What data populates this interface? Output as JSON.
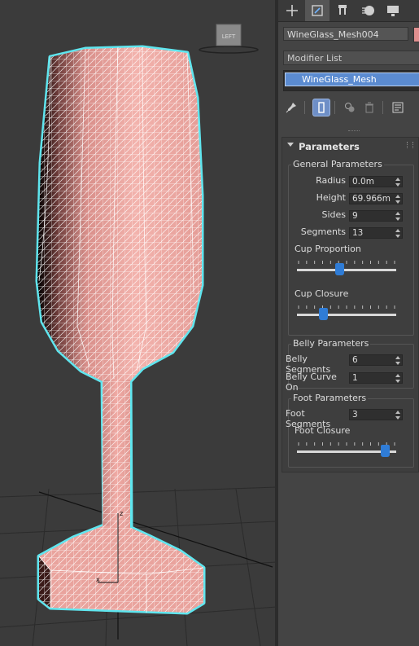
{
  "viewport": {
    "label": "LEFT",
    "background": "#3b3b3b",
    "mesh_color": "#eaa09a",
    "wire_color": "#ffffff",
    "selection_outline_color": "#5fe6ef"
  },
  "command_panel": {
    "tabs": [
      {
        "name": "create-tab",
        "icon": "plus-icon"
      },
      {
        "name": "modify-tab",
        "icon": "modify-icon",
        "active": true
      },
      {
        "name": "hierarchy-tab",
        "icon": "hierarchy-icon"
      },
      {
        "name": "motion-tab",
        "icon": "motion-icon"
      },
      {
        "name": "display-tab",
        "icon": "display-icon"
      }
    ],
    "object_name": "WineGlass_Mesh004",
    "object_color": "#e08f8f",
    "modifier_list_label": "Modifier List",
    "modifier_stack": [
      "WineGlass_Mesh"
    ]
  },
  "parameters": {
    "title": "Parameters",
    "general": {
      "title": "General Parameters",
      "radius_label": "Radius",
      "radius_value": "0.0m",
      "height_label": "Height",
      "height_value": "69.966m",
      "sides_label": "Sides",
      "sides_value": "9",
      "segments_label": "Segments",
      "segments_value": "13",
      "cup_proportion_label": "Cup Proportion",
      "cup_proportion_level": 0.42,
      "cup_closure_label": "Cup Closure",
      "cup_closure_level": 0.24
    },
    "belly": {
      "title": "Belly Parameters",
      "belly_segments_label": "Belly Segments",
      "belly_segments_value": "6",
      "belly_curve_label": "Belly Curve On",
      "belly_curve_value": "1"
    },
    "foot": {
      "title": "Foot Parameters",
      "foot_segments_label": "Foot Segments",
      "foot_segments_value": "3",
      "foot_closure_label": "Foot Closure",
      "foot_closure_level": 0.93
    }
  }
}
